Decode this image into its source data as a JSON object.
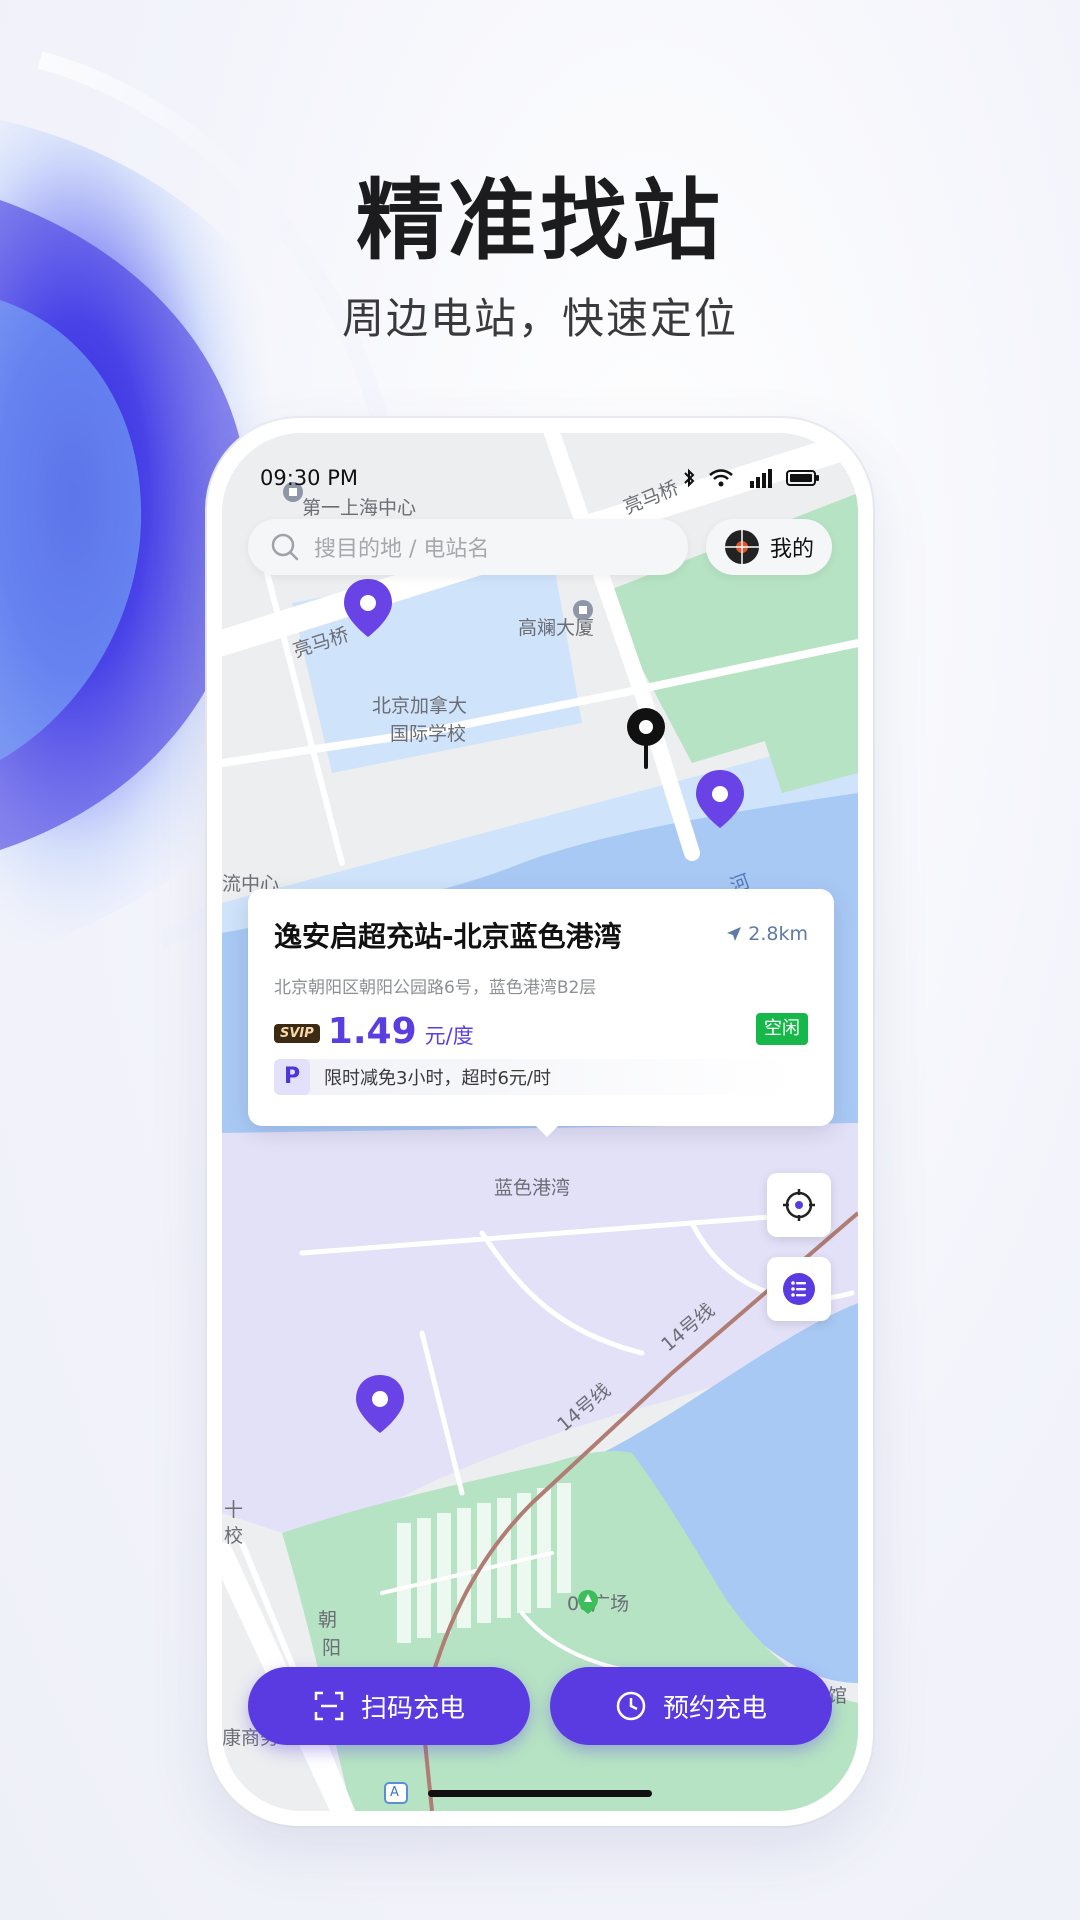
{
  "hero": {
    "title": "精准找站",
    "subtitle": "周边电站，快速定位"
  },
  "status_bar": {
    "time": "09:30 PM",
    "icons": [
      "bluetooth-icon",
      "wifi-icon",
      "5g-signal-icon",
      "battery-icon"
    ]
  },
  "search": {
    "placeholder": "搜目的地 / 电站名"
  },
  "mine_button": {
    "label": "我的"
  },
  "map_labels": {
    "shanghai_center": "第一上海中心",
    "liangma_bridge_top": "亮马桥",
    "liangma_bridge_left": "亮马桥",
    "gaolan_building": "高斓大厦",
    "canada_school_1": "北京加拿大",
    "canada_school_2": "国际学校",
    "liu_center": "流中心",
    "river": "河",
    "blue_harbor": "蓝色港湾",
    "line14_a": "14号线",
    "line14_b": "14号线",
    "plaza": "08广场",
    "school_1": "十",
    "school_2": "校",
    "chaoyang_1": "朝",
    "chaoyang_2": "阳",
    "business": "康商务",
    "museum": "馆",
    "metro_a": "A"
  },
  "station_card": {
    "name": "逸安启超充站-北京蓝色港湾",
    "distance": "2.8km",
    "address": "北京朝阳区朝阳公园路6号，蓝色港湾B2层",
    "svip_label": "SVIP",
    "price": "1.49",
    "unit": "元/度",
    "status": "空闲",
    "parking_badge": "P",
    "parking_text": "限时减免3小时，超时6元/时"
  },
  "actions": {
    "scan": "扫码充电",
    "reserve": "预约充电"
  },
  "colors": {
    "accent": "#5a3be2",
    "status_free": "#16b84a",
    "water": "#a9c9f5",
    "park_green": "#b6e3c3",
    "harbor_lilac": "#e3e1f7"
  }
}
